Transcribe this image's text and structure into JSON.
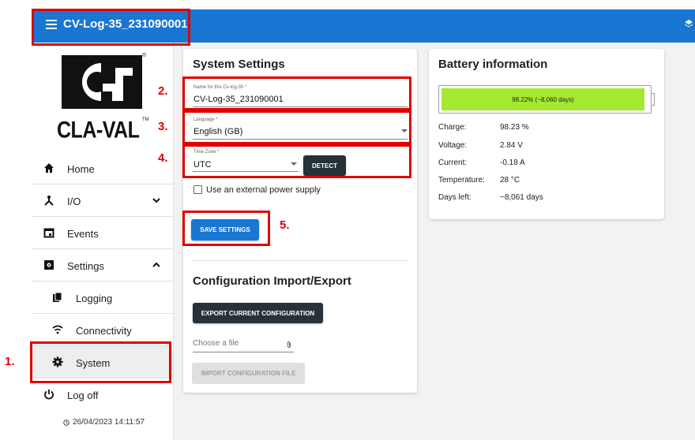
{
  "header": {
    "title": "CV-Log-35_231090001",
    "menu_icon": "menu-icon",
    "right_icon": "layers-icon"
  },
  "brand": {
    "logo_text": "CLA-VAL",
    "trademark": "TM",
    "registered": "®"
  },
  "sidebar": {
    "items": [
      {
        "label": "Home",
        "icon": "home-icon"
      },
      {
        "label": "I/O",
        "icon": "fork-icon"
      },
      {
        "label": "Events",
        "icon": "calendar-icon"
      },
      {
        "label": "Settings",
        "icon": "settings-box-icon"
      },
      {
        "label": "Logging",
        "icon": "file-copy-icon"
      },
      {
        "label": "Connectivity",
        "icon": "wifi-icon"
      },
      {
        "label": "System",
        "icon": "gear-icon"
      },
      {
        "label": "Log off",
        "icon": "power-icon"
      }
    ],
    "datetime": "26/04/2023 14:11:57"
  },
  "system_settings": {
    "title": "System Settings",
    "name_label": "Name for this Cv-log-35 *",
    "name_value": "CV-Log-35_231090001",
    "language_label": "Language *",
    "language_value": "English (GB)",
    "timezone_label": "Time Zone *",
    "timezone_value": "UTC",
    "detect_label": "DETECT",
    "external_power_label": "Use an external power supply",
    "external_power_checked": false,
    "save_label": "SAVE SETTINGS"
  },
  "config": {
    "title": "Configuration Import/Export",
    "export_label": "EXPORT CURRENT CONFIGURATION",
    "file_placeholder": "Choose a file",
    "import_label": "IMPORT CONFIGURATION FILE"
  },
  "battery": {
    "title": "Battery information",
    "bar_label": "98.22% (~8,060 days)",
    "level": 0.9822,
    "fill_color": "#a4e830",
    "rows": [
      {
        "key": "Charge:",
        "value": "98.23 %"
      },
      {
        "key": "Voltage:",
        "value": "2.84 V"
      },
      {
        "key": "Current:",
        "value": "-0.18 A"
      },
      {
        "key": "Temperature:",
        "value": "28 °C"
      },
      {
        "key": "Days left:",
        "value": "~8,061 days"
      }
    ]
  },
  "annotations": {
    "steps": [
      "1.",
      "2.",
      "3.",
      "4.",
      "5."
    ],
    "color": "#e00000"
  },
  "colors": {
    "primary": "#1976d2",
    "dark_button": "#263238"
  }
}
